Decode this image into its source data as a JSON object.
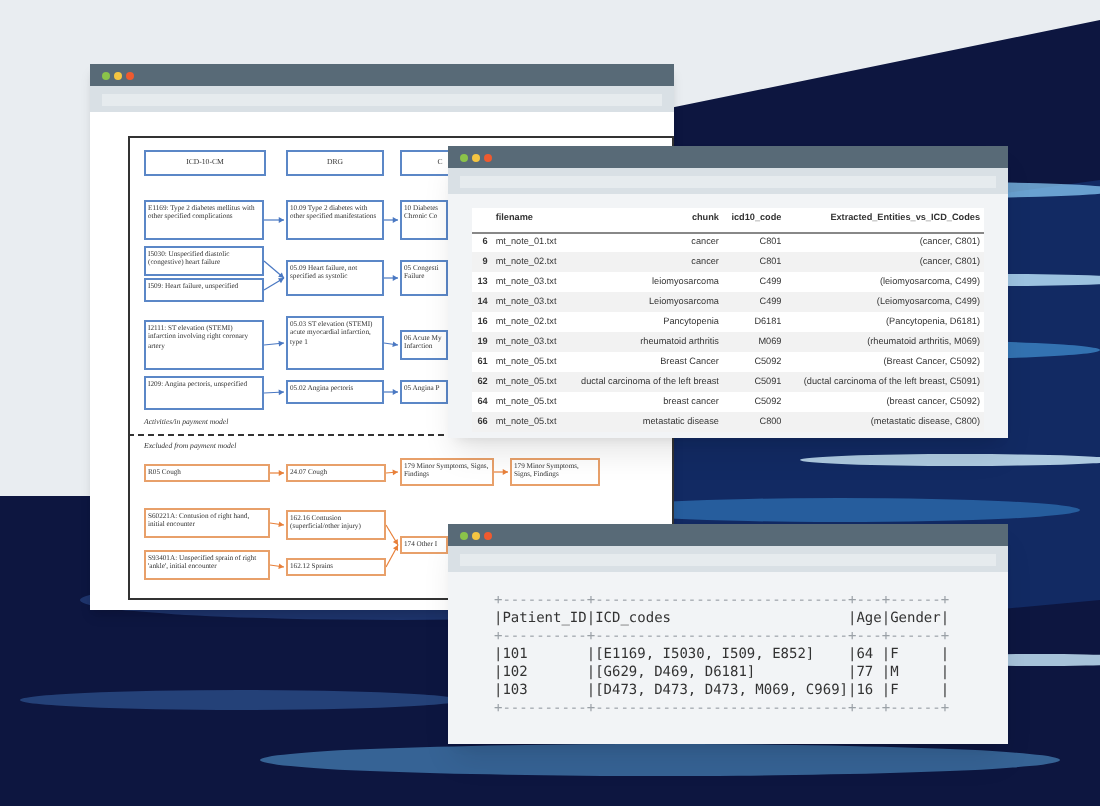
{
  "diagram_window": {
    "columns": [
      "ICD-10-CM",
      "DRG",
      "C"
    ],
    "included_nodes": [
      {
        "text": "E1169: Type 2 diabetes mellitus with other specified complications"
      },
      {
        "text": "I5030: Unspecified diastolic (congestive) heart failure"
      },
      {
        "text": "I509: Heart failure, unspecified"
      },
      {
        "text": "I2111: ST elevation (STEMI) infarction involving right coronary artery"
      },
      {
        "text": "I209: Angina pectoris, unspecified"
      },
      {
        "text": "10.09 Type 2 diabetes with other specified manifestations"
      },
      {
        "text": "05.09 Heart failure, not specified as systolic"
      },
      {
        "text": "05.03 ST elevation (STEMI) acute myocardial infarction, type 1"
      },
      {
        "text": "05.02 Angina pectoris"
      },
      {
        "text": "10 Diabetes Chronic Co"
      },
      {
        "text": "05 Congesti Failure"
      },
      {
        "text": "06 Acute My Infarction"
      },
      {
        "text": "05 Angina P"
      }
    ],
    "included_label": "Activities/in payment model",
    "excluded_label": "Excluded from payment model",
    "excluded_nodes": [
      {
        "text": "R05 Cough"
      },
      {
        "text": "24.07 Cough"
      },
      {
        "text": "179 Minor Symptoms, Signs, Findings"
      },
      {
        "text": "179 Minor Symptoms, Signs, Findings"
      },
      {
        "text": "S60221A: Contusion of right hand, initial encounter"
      },
      {
        "text": "162.16 Contusion (superficial/other injury)"
      },
      {
        "text": "S93401A: Unspecified sprain of right 'ankle', initial encounter"
      },
      {
        "text": "162.12 Sprains"
      },
      {
        "text": "174 Other I"
      }
    ]
  },
  "table_window": {
    "columns": [
      "filename",
      "chunk",
      "icd10_code",
      "Extracted_Entities_vs_ICD_Codes"
    ],
    "rows": [
      {
        "index": "6",
        "cells": [
          "mt_note_01.txt",
          "cancer",
          "C801",
          "(cancer, C801)"
        ]
      },
      {
        "index": "9",
        "cells": [
          "mt_note_02.txt",
          "cancer",
          "C801",
          "(cancer, C801)"
        ]
      },
      {
        "index": "13",
        "cells": [
          "mt_note_03.txt",
          "leiomyosarcoma",
          "C499",
          "(leiomyosarcoma, C499)"
        ]
      },
      {
        "index": "14",
        "cells": [
          "mt_note_03.txt",
          "Leiomyosarcoma",
          "C499",
          "(Leiomyosarcoma, C499)"
        ]
      },
      {
        "index": "16",
        "cells": [
          "mt_note_02.txt",
          "Pancytopenia",
          "D6181",
          "(Pancytopenia, D6181)"
        ]
      },
      {
        "index": "19",
        "cells": [
          "mt_note_03.txt",
          "rheumatoid arthritis",
          "M069",
          "(rheumatoid arthritis, M069)"
        ]
      },
      {
        "index": "61",
        "cells": [
          "mt_note_05.txt",
          "Breast Cancer",
          "C5092",
          "(Breast Cancer, C5092)"
        ]
      },
      {
        "index": "62",
        "cells": [
          "mt_note_05.txt",
          "ductal carcinoma of the left breast",
          "C5091",
          "(ductal carcinoma of the left breast, C5091)"
        ]
      },
      {
        "index": "64",
        "cells": [
          "mt_note_05.txt",
          "breast cancer",
          "C5092",
          "(breast cancer, C5092)"
        ]
      },
      {
        "index": "66",
        "cells": [
          "mt_note_05.txt",
          "metastatic disease",
          "C800",
          "(metastatic disease, C800)"
        ]
      }
    ]
  },
  "console_window": {
    "lines": [
      {
        "kind": "border",
        "text": "+----------+------------------------------+---+------+"
      },
      {
        "kind": "row",
        "text": "|Patient_ID|ICD_codes                     |Age|Gender|"
      },
      {
        "kind": "border",
        "text": "+----------+------------------------------+---+------+"
      },
      {
        "kind": "row",
        "text": "|101       |[E1169, I5030, I509, E852]    |64 |F     |"
      },
      {
        "kind": "row",
        "text": "|102       |[G629, D469, D6181]           |77 |M     |"
      },
      {
        "kind": "row",
        "text": "|103       |[D473, D473, D473, M069, C969]|16 |F     |"
      },
      {
        "kind": "border",
        "text": "+----------+------------------------------+---+------+"
      }
    ]
  }
}
